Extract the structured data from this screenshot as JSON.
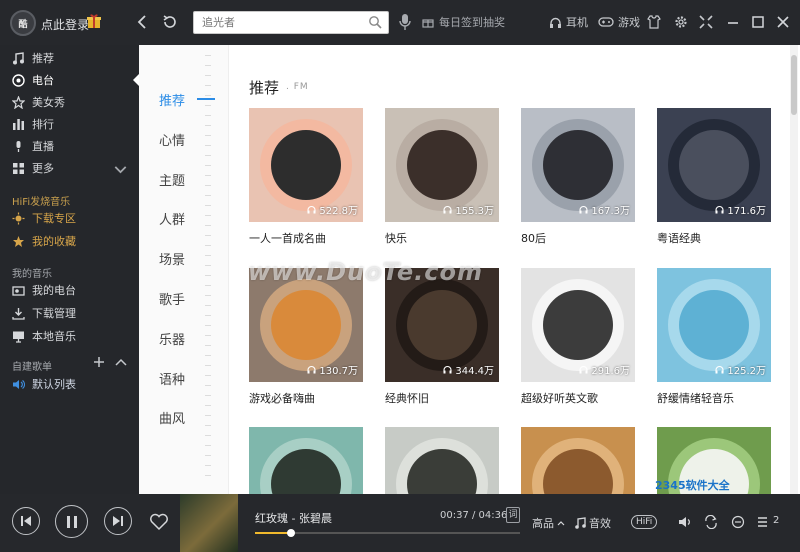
{
  "header": {
    "login_label": "点此登录",
    "search": {
      "placeholder": "追光者"
    },
    "checkin_label": "每日签到抽奖",
    "earphone_label": "耳机",
    "game_label": "游戏"
  },
  "sidebar": {
    "items": [
      {
        "label": "推荐",
        "icon": "music-note-icon"
      },
      {
        "label": "电台",
        "icon": "radio-icon"
      },
      {
        "label": "美女秀",
        "icon": "star-icon"
      },
      {
        "label": "排行",
        "icon": "chart-bars-icon"
      },
      {
        "label": "直播",
        "icon": "mic-icon"
      },
      {
        "label": "更多",
        "icon": "grid-icon"
      }
    ],
    "hifi_head": "HiFi发烧音乐",
    "hifi_items": [
      {
        "label": "下载专区",
        "icon": "sun-icon"
      },
      {
        "label": "我的收藏",
        "icon": "star-icon"
      }
    ],
    "my_music_head": "我的音乐",
    "my_items": [
      {
        "label": "我的电台",
        "icon": "radio-icon"
      },
      {
        "label": "下载管理",
        "icon": "download-icon"
      },
      {
        "label": "本地音乐",
        "icon": "monitor-icon"
      }
    ],
    "custom_head": "自建歌单",
    "playlist_items": [
      {
        "label": "默认列表",
        "icon": "speaker-icon"
      }
    ]
  },
  "categories": [
    "推荐",
    "心情",
    "主题",
    "人群",
    "场景",
    "歌手",
    "乐器",
    "语种",
    "曲风"
  ],
  "content": {
    "title": "推荐",
    "subtitle": ". FM",
    "cards": [
      {
        "name": "一人一首成名曲",
        "plays": "522.8万",
        "bg": "#e9c3b2",
        "disc": "#f3b9a1",
        "inner": "#2d2d2d"
      },
      {
        "name": "快乐",
        "plays": "155.3万",
        "bg": "#c9c0b6",
        "disc": "#b9ada3",
        "inner": "#3b2f2a"
      },
      {
        "name": "80后",
        "plays": "167.3万",
        "bg": "#b9bec6",
        "disc": "#9aa1ab",
        "inner": "#2e2f35"
      },
      {
        "name": "粤语经典",
        "plays": "171.6万",
        "bg": "#3b4152",
        "disc": "#242a38",
        "inner": "#4a4f5d"
      },
      {
        "name": "游戏必备嗨曲",
        "plays": "130.7万",
        "bg": "#8d7a6c",
        "disc": "#c9a27d",
        "inner": "#d98a3b"
      },
      {
        "name": "经典怀旧",
        "plays": "344.4万",
        "bg": "#3a2e28",
        "disc": "#231b17",
        "inner": "#4a3a2e"
      },
      {
        "name": "超级好听英文歌",
        "plays": "291.6万",
        "bg": "#e3e3e3",
        "disc": "#f5f5f5",
        "inner": "#3c3c3c"
      },
      {
        "name": "舒缓情绪轻音乐",
        "plays": "125.2万",
        "bg": "#7ec3df",
        "disc": "#a7d9ec",
        "inner": "#5eb1d4"
      },
      {
        "name": "",
        "plays": "",
        "bg": "#7fb7ac",
        "disc": "#a8cfc5",
        "inner": "#2f3a33"
      },
      {
        "name": "",
        "plays": "",
        "bg": "#c7cbc6",
        "disc": "#dde0db",
        "inner": "#3a3d38"
      },
      {
        "name": "",
        "plays": "",
        "bg": "#c8904e",
        "disc": "#e0b27a",
        "inner": "#8c5a2e"
      },
      {
        "name": "",
        "plays": "",
        "bg": "#6f9c4d",
        "disc": "#9cc77a",
        "inner": "#eef2ea"
      }
    ]
  },
  "watermark": "www.DuoTe.com",
  "corner_brand": "2345软件大全",
  "player": {
    "song": "红玫瑰 - 张碧晨",
    "time": "00:37 / 04:36",
    "progress_fraction": 0.134,
    "lyric_label": "词",
    "quality_label": "高品",
    "effect_label": "音效",
    "hifi_label": "HiFi",
    "playlist_count": "2"
  },
  "colors": {
    "accent": "#2b8ce6",
    "progress": "#f0b92d",
    "sidebar_bg": "#25272b",
    "gold": "#d7a54a"
  }
}
